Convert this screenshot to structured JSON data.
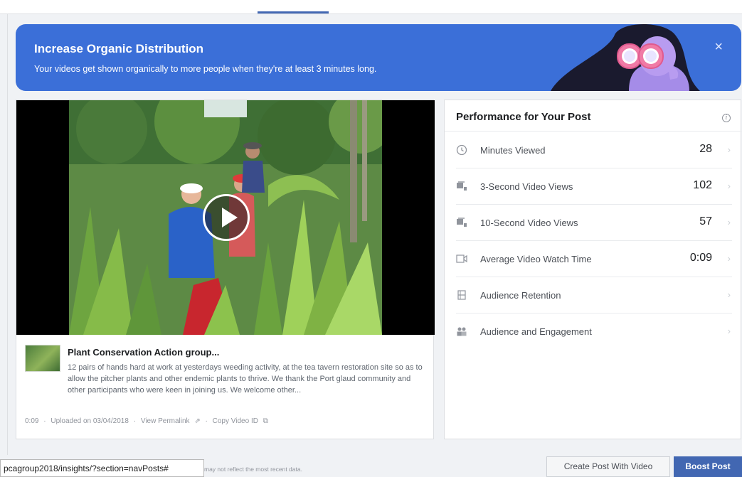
{
  "banner": {
    "title": "Increase Organic Distribution",
    "subtitle": "Your videos get shown organically to more people when they're at least 3 minutes long.",
    "close": "×"
  },
  "post": {
    "title": "Plant Conservation Action group...",
    "description": "12 pairs of hands hard at work at yesterdays weeding activity, at the tea tavern restoration site so as to allow the pitcher plants and other endemic plants to thrive. We thank the Port glaud community and other participants who were keen in joining us. We welcome other...",
    "meta": {
      "duration": "0:09",
      "separator": "·",
      "uploaded": "Uploaded on 03/04/2018",
      "permalink": "View Permalink",
      "copy_id": "Copy Video ID"
    }
  },
  "performance": {
    "title": "Performance for Your Post",
    "info": "i",
    "chevron": "›",
    "rows": [
      {
        "icon": "clock-icon",
        "label": "Minutes Viewed",
        "value": "28"
      },
      {
        "icon": "video-views-icon",
        "label": "3-Second Video Views",
        "value": "102"
      },
      {
        "icon": "video-views-icon",
        "label": "10-Second Video Views",
        "value": "57"
      },
      {
        "icon": "video-camera-icon",
        "label": "Average Video Watch Time",
        "value": "0:09"
      },
      {
        "icon": "film-icon",
        "label": "Audience Retention",
        "value": ""
      },
      {
        "icon": "people-icon",
        "label": "Audience and Engagement",
        "value": ""
      }
    ]
  },
  "footer": {
    "status_url": "pcagroup2018/insights/?section=navPosts#",
    "note": "may not reflect the most recent data.",
    "create_button": "Create Post With Video",
    "boost_button": "Boost Post"
  },
  "colors": {
    "banner": "#3b6fd8",
    "primary_button": "#4267b2"
  }
}
